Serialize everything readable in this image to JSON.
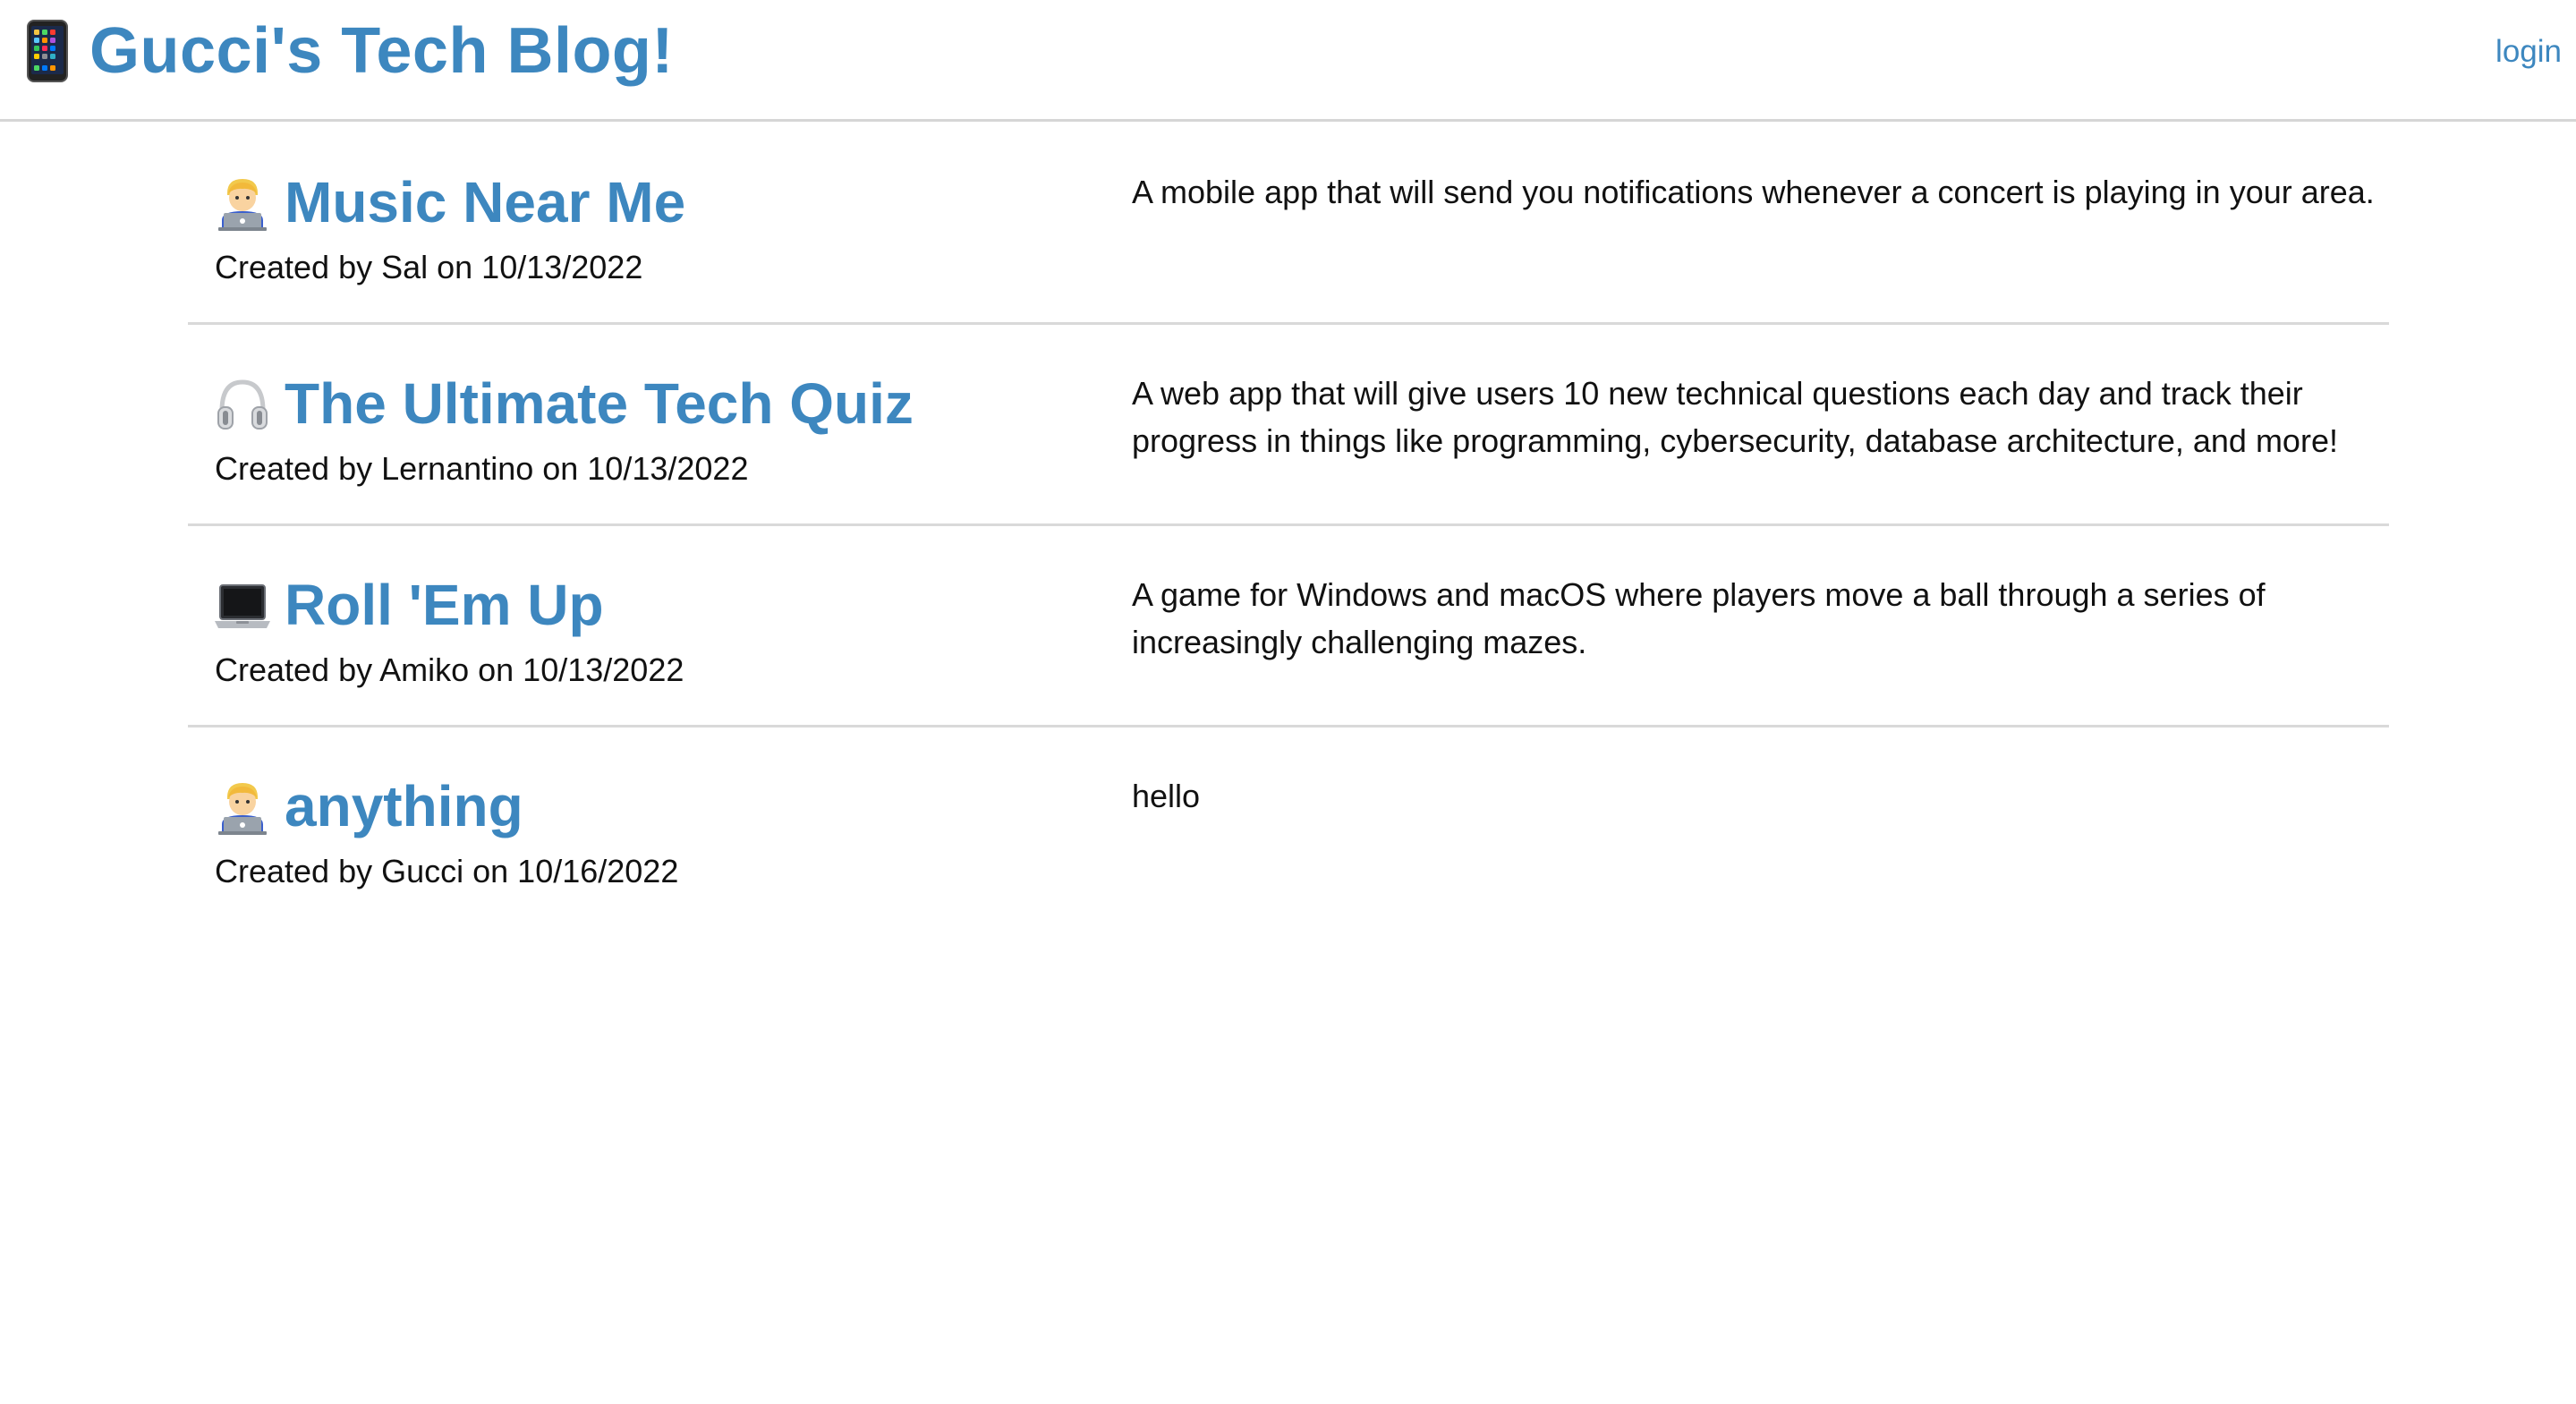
{
  "header": {
    "site_title": "Gucci's Tech Blog!",
    "login_label": "login"
  },
  "posts": [
    {
      "icon": "technologist-icon",
      "title": "Music Near Me",
      "meta": "Created by Sal on 10/13/2022",
      "description": "A mobile app that will send you notifications whenever a concert is playing in your area."
    },
    {
      "icon": "headphones-icon",
      "title": "The Ultimate Tech Quiz",
      "meta": "Created by Lernantino on 10/13/2022",
      "description": "A web app that will give users 10 new technical questions each day and track their progress in things like programming, cybersecurity, database architecture, and more!"
    },
    {
      "icon": "laptop-icon",
      "title": "Roll 'Em Up",
      "meta": "Created by Amiko on 10/13/2022",
      "description": "A game for Windows and macOS where players move a ball through a series of increasingly challenging mazes."
    },
    {
      "icon": "technologist-icon",
      "title": "anything",
      "meta": "Created by Gucci on 10/16/2022",
      "description": "hello"
    }
  ],
  "colors": {
    "link_blue": "#3d87bf",
    "divider": "#d9d9d9"
  }
}
